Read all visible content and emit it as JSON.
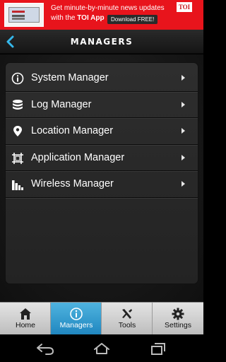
{
  "ad": {
    "line1": "Get minute-by-minute news updates",
    "line2_prefix": "with the",
    "line2_brand": "TOI App",
    "download_label": "Download FREE!",
    "logo_text": "TOI"
  },
  "header": {
    "title": "MANAGERS"
  },
  "menu": {
    "items": [
      {
        "label": "System Manager",
        "icon": "info-icon"
      },
      {
        "label": "Log Manager",
        "icon": "database-icon"
      },
      {
        "label": "Location Manager",
        "icon": "location-pin-icon"
      },
      {
        "label": "Application Manager",
        "icon": "app-frame-icon"
      },
      {
        "label": "Wireless Manager",
        "icon": "signal-bars-icon"
      }
    ]
  },
  "tabs": {
    "items": [
      {
        "label": "Home",
        "icon": "home-icon"
      },
      {
        "label": "Managers",
        "icon": "info-icon"
      },
      {
        "label": "Tools",
        "icon": "tools-icon"
      },
      {
        "label": "Settings",
        "icon": "gear-icon"
      }
    ],
    "active": "Managers"
  },
  "colors": {
    "accent": "#2a9fd6",
    "ad_background": "#e8141c"
  }
}
